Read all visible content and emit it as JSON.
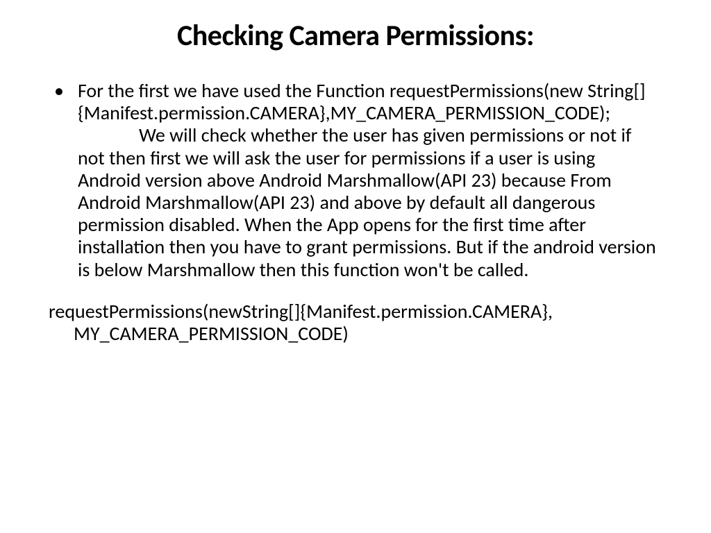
{
  "title": "Checking Camera Permissions:",
  "bullet": {
    "line1": "For the first we have used the Function requestPermissions(new String[]{Manifest.permission.CAMERA},MY_CAMERA_PERMISSION_CODE);",
    "line2": "We will check whether the user has given permissions or not if not then first we will ask the user for permissions if a user is using Android version above Android Marshmallow(API 23) because From Android Marshmallow(API 23) and above by default all dangerous permission disabled. When the App opens for the first time after installation then you have to grant permissions. But if the android version is below Marshmallow then this function won't be called."
  },
  "code_line": "requestPermissions(newString[]{Manifest.permission.CAMERA}, MY_CAMERA_PERMISSION_CODE)"
}
